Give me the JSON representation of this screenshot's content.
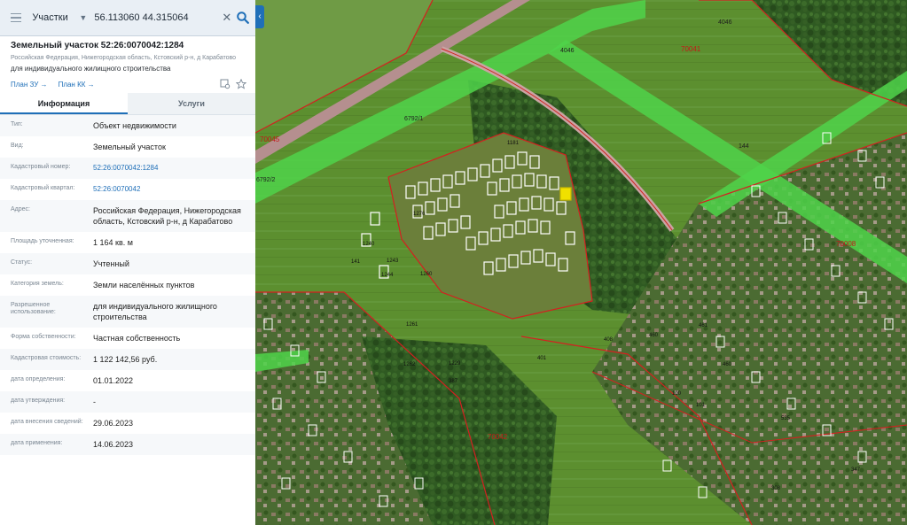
{
  "search": {
    "type_label": "Участки",
    "query": "56.113060 44.315064"
  },
  "object": {
    "title": "Земельный участок 52:26:0070042:1284",
    "address_line": "Российская Федерация, Нижегородская область, Кстовский р-н, д Карабатово",
    "usage": "для индивидуального жилищного строительства",
    "links": [
      {
        "label": "План ЗУ →"
      },
      {
        "label": "План КК →"
      }
    ]
  },
  "tabs": [
    {
      "label": "Информация",
      "active": true
    },
    {
      "label": "Услуги",
      "active": false
    }
  ],
  "properties": [
    {
      "label": "Тип:",
      "value": "Объект недвижимости"
    },
    {
      "label": "Вид:",
      "value": "Земельный участок"
    },
    {
      "label": "Кадастровый номер:",
      "value": "52:26:0070042:1284",
      "link": true
    },
    {
      "label": "Кадастровый квартал:",
      "value": "52:26:0070042",
      "link": true
    },
    {
      "label": "Адрес:",
      "value": "Российская Федерация, Нижегородская область, Кстовский р-н, д Карабатово"
    },
    {
      "label": "Площадь уточненная:",
      "value": "1 164 кв. м"
    },
    {
      "label": "Статус:",
      "value": "Учтенный"
    },
    {
      "label": "Категория земель:",
      "value": "Земли населённых пунктов"
    },
    {
      "label": "Разрешенное использование:",
      "value": "для индивидуального жилищного строительства"
    },
    {
      "label": "Форма собственности:",
      "value": "Частная собственность"
    },
    {
      "label": "Кадастровая стоимость:",
      "value": "1 122 142,56 руб."
    },
    {
      "label": "дата определения:",
      "value": "01.01.2022"
    },
    {
      "label": "дата утверждения:",
      "value": "-"
    },
    {
      "label": "дата внесения сведений:",
      "value": "29.06.2023"
    },
    {
      "label": "дата применения:",
      "value": "14.06.2023"
    }
  ],
  "map": {
    "zone_labels": [
      "70041",
      "70045",
      "70008",
      "70042"
    ],
    "road_labels": [
      "4046",
      "4046",
      "6792/1",
      "6792/2",
      "144"
    ],
    "plot_labels": [
      "1181",
      "1276",
      "1261",
      "1260",
      "1262",
      "1240",
      "1243",
      "1244",
      "141",
      "460",
      "461",
      "460",
      "401",
      "387",
      "535",
      "347",
      "308",
      "100",
      "101",
      "1229",
      "408"
    ],
    "colors": {
      "zone_green": "#4fd44a",
      "boundary_red": "#d42020",
      "road": "#c9a3a3",
      "accent": "#1f6fb8",
      "selected": "#f0e000"
    }
  }
}
